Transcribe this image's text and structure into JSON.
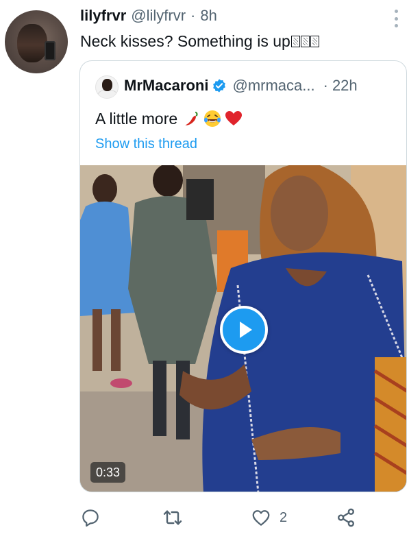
{
  "tweet": {
    "author": {
      "display_name": "lilyfrvr",
      "handle": "@lilyfrvr",
      "time": "8h"
    },
    "text": "Neck kisses? Something is up",
    "trailing_glyphs": [
      "box-glyph",
      "box-glyph",
      "box-glyph"
    ],
    "more_icon": "more-dots-icon"
  },
  "quoted": {
    "author": {
      "display_name": "MrMacaroni",
      "handle": "@mrmaca...",
      "time": "22h",
      "verified": true
    },
    "text": "A little more",
    "emojis": [
      "🌶️",
      "😂",
      "❤️"
    ],
    "show_thread_label": "Show this thread",
    "video": {
      "duration": "0:33",
      "play_icon": "play-icon"
    }
  },
  "actions": {
    "reply_icon": "reply-icon",
    "retweet_icon": "retweet-icon",
    "like_icon": "heart-icon",
    "like_count": "2",
    "share_icon": "share-icon"
  },
  "colors": {
    "accent": "#1d9bf0",
    "secondary_text": "#536471",
    "primary_text": "#0f1419",
    "border": "#cfd9de"
  }
}
